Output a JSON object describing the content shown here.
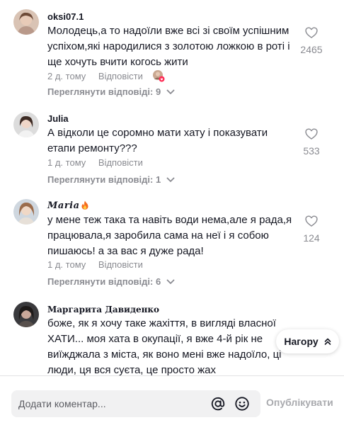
{
  "comments": [
    {
      "username": "oksi07.1",
      "text": "Молодець,а то надоїли вже всі зі своїм успішним успіхом,які народилися з золотою ложкою в роті і ще хочуть вчити когось жити",
      "time": "2 д. тому",
      "reply_label": "Відповісти",
      "likes": "2465",
      "view_replies": "Переглянути відповіді: 9"
    },
    {
      "username": "Julia",
      "text": "А відколи це соромно мати хату і показувати етапи ремонту???",
      "time": "1 д. тому",
      "reply_label": "Відповісти",
      "likes": "533",
      "view_replies": "Переглянути відповіді: 1"
    },
    {
      "username": "𝑴𝒂𝒓𝒊𝒂",
      "text": "у мене теж така та навіть води нема,але я рада,я працювала,я заробила сама на неї і я собою пишаюсь! а за вас я дуже рада!",
      "time": "1 д. тому",
      "reply_label": "Відповісти",
      "likes": "124",
      "view_replies": "Переглянути відповіді: 6"
    },
    {
      "username": "Маргарита Давиденко",
      "text": "боже, як я хочу таке жахіття, в вигляді власної ХАТИ... моя хата в окупації, я вже 4-й рік не виїжджала з міста, як воно мені вже надоїло, ці люди, ця вся суєта, це просто жах"
    }
  ],
  "top_button": {
    "label": "Нагору"
  },
  "composer": {
    "placeholder": "Додати коментар...",
    "post_label": "Опублікувати"
  },
  "icons": {
    "heart": "heart-outline-icon",
    "mention": "at-sign-icon",
    "emoji": "smile-emoji-icon",
    "chevron": "chevron-down-icon",
    "top": "chevron-up-double-icon"
  },
  "colors": {
    "text": "#161823",
    "secondary": "#8a8b91",
    "input_bg": "#f1f1f2",
    "creator_badge": "#fe2c55"
  }
}
